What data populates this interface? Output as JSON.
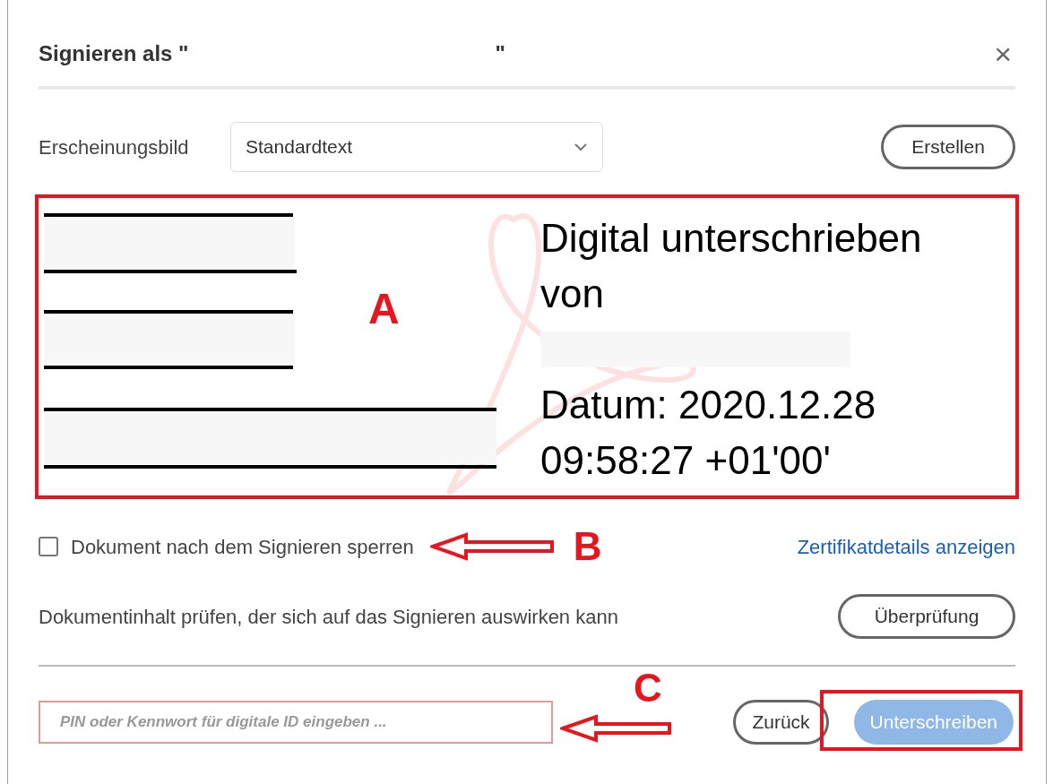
{
  "dialog": {
    "title": "Signieren als \"",
    "title_end": "\"",
    "close": "×"
  },
  "appearance": {
    "label": "Erscheinungsbild",
    "value": "Standardtext",
    "create_button": "Erstellen"
  },
  "preview": {
    "lines": [
      {
        "kind": "text",
        "text": "Digital unterschrieben"
      },
      {
        "kind": "text",
        "text": "von"
      },
      {
        "kind": "redacted"
      },
      {
        "kind": "text",
        "text": "Datum: 2020.12.28"
      },
      {
        "kind": "text",
        "text": "09:58:27 +01'00'"
      }
    ]
  },
  "lock_option": {
    "label": "Dokument nach dem Signieren sperren",
    "checked": false
  },
  "certificate_link": "Zertifikatdetails anzeigen",
  "review": {
    "text": "Dokumentinhalt prüfen, der sich auf das Signieren auswirken kann",
    "button": "Überprüfung"
  },
  "pin_field": {
    "placeholder": "PIN oder Kennwort für digitale ID eingeben ..."
  },
  "buttons": [
    {
      "label": "Zurück",
      "disabled": false
    },
    {
      "label": "Unterschreiben",
      "disabled": true
    }
  ],
  "annotations": [
    {
      "label": "A"
    },
    {
      "label": "B"
    },
    {
      "label": "C"
    }
  ]
}
